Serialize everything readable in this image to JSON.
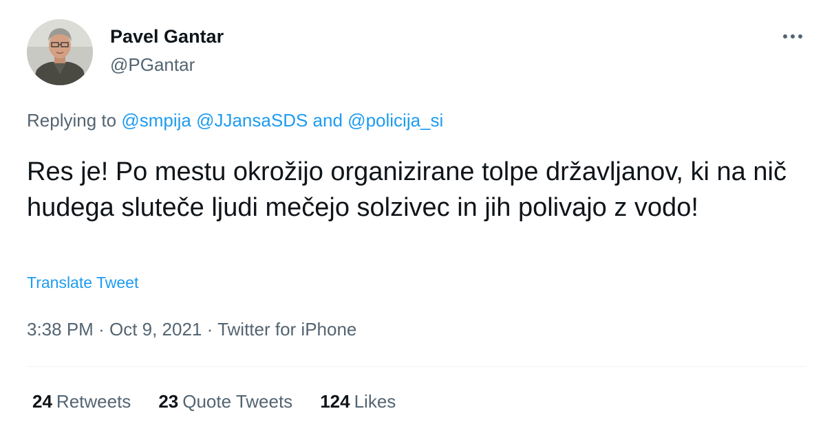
{
  "author": {
    "name": "Pavel Gantar",
    "handle": "@PGantar"
  },
  "reply": {
    "prefix": "Replying to",
    "mentions": [
      "@smpija",
      "@JJansaSDS",
      "@policija_si"
    ],
    "conjunction": "and"
  },
  "tweet": {
    "text": "Res je! Po mestu okrožijo organizirane tolpe državljanov, ki na nič hudega sluteče ljudi mečejo solzivec in jih polivajo z vodo!",
    "translate_label": "Translate Tweet",
    "time": "3:38 PM",
    "date": "Oct 9, 2021",
    "source": "Twitter for iPhone",
    "separator": "·"
  },
  "stats": {
    "retweets": {
      "count": "24",
      "label": "Retweets"
    },
    "quotes": {
      "count": "23",
      "label": "Quote Tweets"
    },
    "likes": {
      "count": "124",
      "label": "Likes"
    }
  },
  "icons": {
    "avatar": "profile-photo",
    "more": "more-horizontal-icon"
  },
  "colors": {
    "primary_text": "#0f1419",
    "secondary_text": "#536471",
    "link": "#1d9bf0",
    "divider": "#eff3f4"
  }
}
